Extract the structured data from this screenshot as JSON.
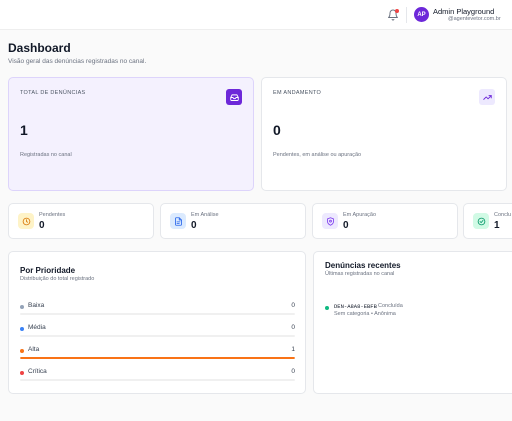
{
  "header": {
    "avatar_initials": "AP",
    "user_name": "Admin Playground",
    "user_email": "@agentevetor.com.br",
    "notification_icon": "bell-icon"
  },
  "page": {
    "title": "Dashboard",
    "subtitle": "Visão geral das denúncias registradas no canal."
  },
  "summary_cards": [
    {
      "label": "Total de Denúncias",
      "value": "1",
      "note": "Registradas no canal",
      "icon": "inbox-icon"
    },
    {
      "label": "Em Andamento",
      "value": "0",
      "note": "Pendentes, em análise ou apuração",
      "icon": "trending-up-icon"
    }
  ],
  "status_cards": [
    {
      "label": "Pendentes",
      "value": "0",
      "icon": "clock-icon",
      "color": "#d97706",
      "bg": "#fef3c7"
    },
    {
      "label": "Em Análise",
      "value": "0",
      "icon": "document-icon",
      "color": "#2563eb",
      "bg": "#dbeafe"
    },
    {
      "label": "Em Apuração",
      "value": "0",
      "icon": "shield-icon",
      "color": "#7c3aed",
      "bg": "#ede9fe"
    },
    {
      "label": "Conclu",
      "value": "1",
      "icon": "check-circle-icon",
      "color": "#059669",
      "bg": "#d1fae5"
    }
  ],
  "priority": {
    "title": "Por Prioridade",
    "subtitle": "Distribuição do total registrado",
    "items": [
      {
        "label": "Baixa",
        "count": "0",
        "color": "#94a3b8",
        "fraction": 0
      },
      {
        "label": "Média",
        "count": "0",
        "color": "#3b82f6",
        "fraction": 0
      },
      {
        "label": "Alta",
        "count": "1",
        "color": "#f97316",
        "fraction": 1
      },
      {
        "label": "Crítica",
        "count": "0",
        "color": "#ef4444",
        "fraction": 0
      }
    ]
  },
  "recent": {
    "title": "Denúncias recentes",
    "subtitle": "Últimas registradas no canal",
    "items": [
      {
        "code": "DEN-A8A8-EBFB",
        "status": "Concluída",
        "meta": "Sem categoria • Anônima"
      }
    ]
  },
  "colors": {
    "accent": "#6d28d9",
    "success": "#10b981"
  }
}
